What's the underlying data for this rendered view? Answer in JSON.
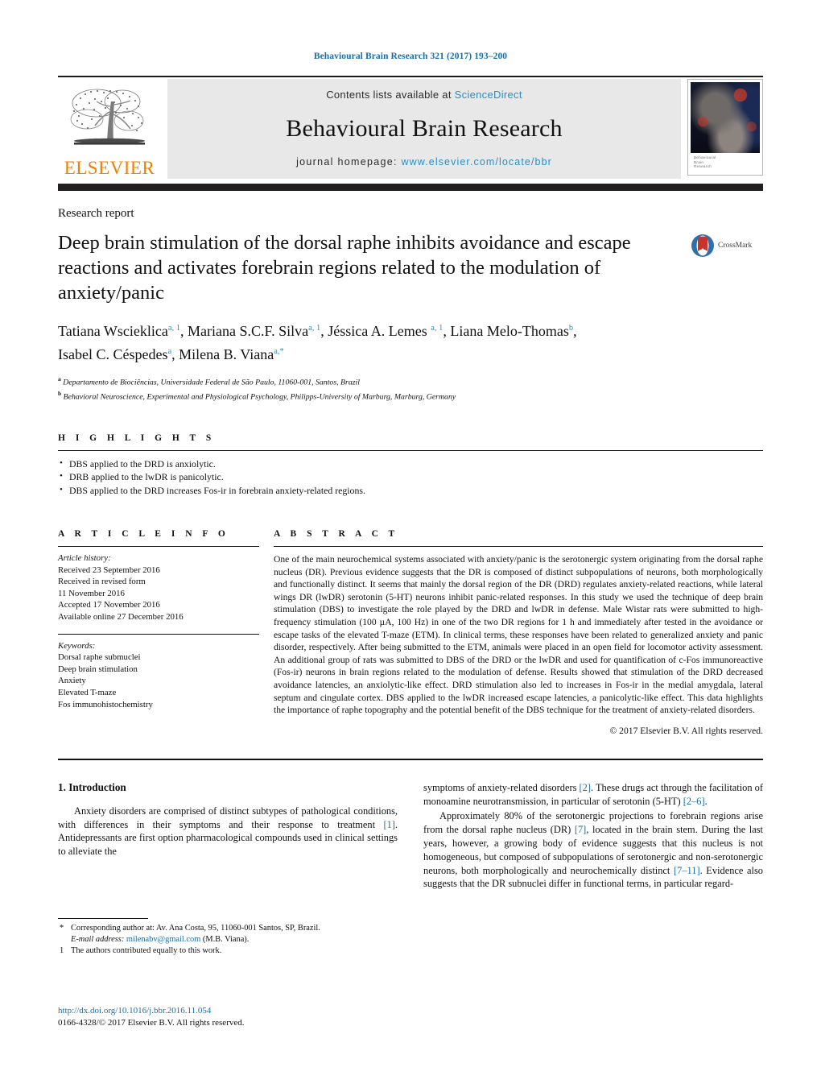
{
  "running_head": "Behavioural Brain Research 321 (2017) 193–200",
  "masthead": {
    "contents_prefix": "Contents lists available at ",
    "sciencedirect": "ScienceDirect",
    "journal_title": "Behavioural Brain Research",
    "homepage_prefix": "journal homepage: ",
    "homepage_url": "www.elsevier.com/locate/bbr",
    "publisher_logo_text": "ELSEVIER",
    "cover_caption": "Behavioural\nBrain\nResearch",
    "link_color": "#2a8fc0",
    "band_color": "#231f20"
  },
  "article": {
    "type": "Research report",
    "title": "Deep brain stimulation of the dorsal raphe inhibits avoidance and escape reactions and activates forebrain regions related to the modulation of anxiety/panic",
    "crossmark_label": "CrossMark",
    "authors_line_1": "Tatiana Wscieklica",
    "authors_html": "Tatiana Wscieklica<sup>a, 1</sup>, Mariana S.C.F. Silva<sup>a, 1</sup>, Jéssica A. Lemes <sup>a, 1</sup>, Liana Melo-Thomas<sup>b</sup>, Isabel C. Céspedes<sup>a</sup>, Milena B. Viana<sup>a,*</sup>",
    "affiliations": [
      {
        "marker": "a",
        "text": "Departamento de Biociências, Universidade Federal de São Paulo, 11060-001, Santos, Brazil"
      },
      {
        "marker": "b",
        "text": "Behavioral Neuroscience, Experimental and Physiological Psychology, Philipps-University of Marburg, Marburg, Germany"
      }
    ]
  },
  "highlights": {
    "heading": "H I G H L I G H T S",
    "items": [
      "DBS applied to the DRD is anxiolytic.",
      "DRB applied to the lwDR is panicolytic.",
      "DBS applied to the DRD increases Fos-ir in forebrain anxiety-related regions."
    ]
  },
  "article_info": {
    "heading": "A R T I C L E   I N F O",
    "history_label": "Article history:",
    "history": [
      "Received 23 September 2016",
      "Received in revised form",
      "11 November 2016",
      "Accepted 17 November 2016",
      "Available online 27 December 2016"
    ],
    "keywords_label": "Keywords:",
    "keywords": [
      "Dorsal raphe submuclei",
      "Deep brain stimulation",
      "Anxiety",
      "Elevated T-maze",
      "Fos immunohistochemistry"
    ]
  },
  "abstract": {
    "heading": "A B S T R A C T",
    "text": "One of the main neurochemical systems associated with anxiety/panic is the serotonergic system originating from the dorsal raphe nucleus (DR). Previous evidence suggests that the DR is composed of distinct subpopulations of neurons, both morphologically and functionally distinct. It seems that mainly the dorsal region of the DR (DRD) regulates anxiety-related reactions, while lateral wings DR (lwDR) serotonin (5-HT) neurons inhibit panic-related responses. In this study we used the technique of deep brain stimulation (DBS) to investigate the role played by the DRD and lwDR in defense. Male Wistar rats were submitted to high-frequency stimulation (100 µA, 100 Hz) in one of the two DR regions for 1 h and immediately after tested in the avoidance or escape tasks of the elevated T-maze (ETM). In clinical terms, these responses have been related to generalized anxiety and panic disorder, respectively. After being submitted to the ETM, animals were placed in an open field for locomotor activity assessment. An additional group of rats was submitted to DBS of the DRD or the lwDR and used for quantification of c-Fos immunoreactive (Fos-ir) neurons in brain regions related to the modulation of defense. Results showed that stimulation of the DRD decreased avoidance latencies, an anxiolytic-like effect. DRD stimulation also led to increases in Fos-ir in the medial amygdala, lateral septum and cingulate cortex. DBS applied to the lwDR increased escape latencies, a panicolytic-like effect. This data highlights the importance of raphe topography and the potential benefit of the DBS technique for the treatment of anxiety-related disorders.",
    "copyright": "© 2017 Elsevier B.V. All rights reserved."
  },
  "body": {
    "section_number_title": "1.  Introduction",
    "left_paragraph_1": "Anxiety disorders are comprised of distinct subtypes of pathological conditions, with differences in their symptoms and their response to treatment [1]. Antidepressants are first option pharmacological compounds used in clinical settings to alleviate the",
    "right_paragraph_1": "symptoms of anxiety-related disorders [2]. These drugs act through the facilitation of monoamine neurotransmission, in particular of serotonin (5-HT) [2–6].",
    "right_paragraph_2": "Approximately 80% of the serotonergic projections to forebrain regions arise from the dorsal raphe nucleus (DR) [7], located in the brain stem. During the last years, however, a growing body of evidence suggests that this nucleus is not homogeneous, but composed of subpopulations of serotonergic and non-serotonergic neurons, both morphologically and neurochemically distinct [7–11]. Evidence also suggests that the DR subnuclei differ in functional terms, in particular regard-",
    "reference_color": "#1a6ea8"
  },
  "footnotes": {
    "corresponding_marker": "*",
    "corresponding_text": "Corresponding author at: Av. Ana Costa, 95, 11060-001 Santos, SP, Brazil.",
    "email_label": "E-mail address:",
    "email": "milenabv@gmail.com",
    "email_attribution": "(M.B. Viana).",
    "equal_marker": "1",
    "equal_text": "The authors contributed equally to this work."
  },
  "doi_block": {
    "doi": "http://dx.doi.org/10.1016/j.bbr.2016.11.054",
    "issn_line": "0166-4328/© 2017 Elsevier B.V. All rights reserved."
  }
}
